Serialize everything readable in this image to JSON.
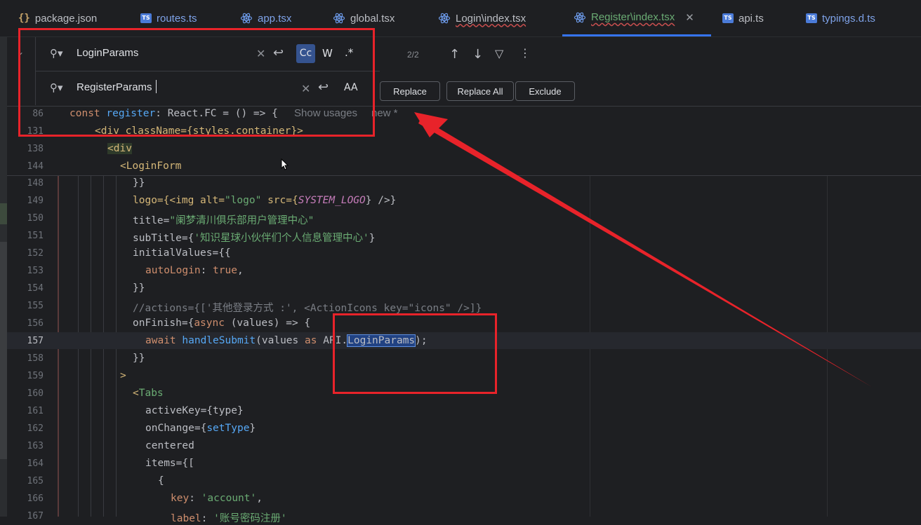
{
  "tabs": [
    {
      "label": "package.json",
      "icon": "json-icon"
    },
    {
      "label": "routes.ts",
      "icon": "ts-icon"
    },
    {
      "label": "app.tsx",
      "icon": "react-icon"
    },
    {
      "label": "global.tsx",
      "icon": "react-icon"
    },
    {
      "label": "Login\\index.tsx",
      "icon": "react-icon"
    },
    {
      "label": "Register\\index.tsx",
      "icon": "react-icon",
      "active": true
    },
    {
      "label": "api.ts",
      "icon": "ts-icon"
    },
    {
      "label": "typings.d.ts",
      "icon": "ts-icon"
    }
  ],
  "ts_badge": "TS",
  "json_glyph": "{}",
  "find": {
    "search_value": "LoginParams",
    "replace_value": "RegisterParams",
    "match_count": "2/2",
    "case_label": "Cc",
    "word_label": "W",
    "regex_label": ".*",
    "preserve_case_label": "AA",
    "replace_button": "Replace",
    "replace_all_button": "Replace All",
    "exclude_button": "Exclude"
  },
  "sticky": {
    "ln86": "86",
    "code86": "const register: React.FC = () => {",
    "show_usages": "Show usages",
    "new_label": "new *",
    "ln131": "131",
    "code131": "<div className={styles.container}>",
    "ln138": "138",
    "code138": "<div",
    "ln144": "144",
    "code144": "<LoginForm"
  },
  "lines": {
    "l148": "148",
    "l149": "149",
    "l150": "150",
    "l151": "151",
    "l152": "152",
    "l153": "153",
    "l154": "154",
    "l155": "155",
    "l156": "156",
    "l157": "157",
    "l158": "158",
    "l159": "159",
    "l160": "160",
    "l161": "161",
    "l162": "162",
    "l163": "163",
    "l164": "164",
    "l165": "165",
    "l166": "166",
    "l167": "167"
  },
  "code": {
    "c148": "}}",
    "c149a": "logo={<img alt=",
    "c149b": "\"logo\"",
    "c149c": " src={",
    "c149d": "SYSTEM_LOGO",
    "c149e": "} />}",
    "c150a": "title=",
    "c150b": "\"阑梦清川俱乐部用户管理中心\"",
    "c151a": "subTitle={",
    "c151b": "'知识星球小伙伴们个人信息管理中心'",
    "c151c": "}",
    "c152": "initialValues={{",
    "c153a": "autoLogin",
    "c153b": ": ",
    "c153c": "true",
    "c153d": ",",
    "c154": "}}",
    "c155": "//actions={['其他登录方式 :', <ActionIcons key=\"icons\" />]}",
    "c156a": "onFinish={",
    "c156b": "async",
    "c156c": " (values) => {",
    "c157a": "await",
    "c157b": " handleSubmit",
    "c157c": "(values ",
    "c157d": "as",
    "c157e": " API.",
    "c157f": "LoginParams",
    "c157g": ");",
    "c158": "}}",
    "c159": ">",
    "c160a": "<",
    "c160b": "Tabs",
    "c161": "activeKey={type}",
    "c162a": "onChange={",
    "c162b": "setType",
    "c162c": "}",
    "c163": "centered",
    "c164": "items={[",
    "c165": "{",
    "c166a": "key",
    "c166b": ": ",
    "c166c": "'account'",
    "c166d": ",",
    "c167a": "label",
    "c167b": ": ",
    "c167c": "'账号密码注册'"
  },
  "colors": {
    "accent": "#3574f0",
    "annotation": "#e8232a"
  }
}
